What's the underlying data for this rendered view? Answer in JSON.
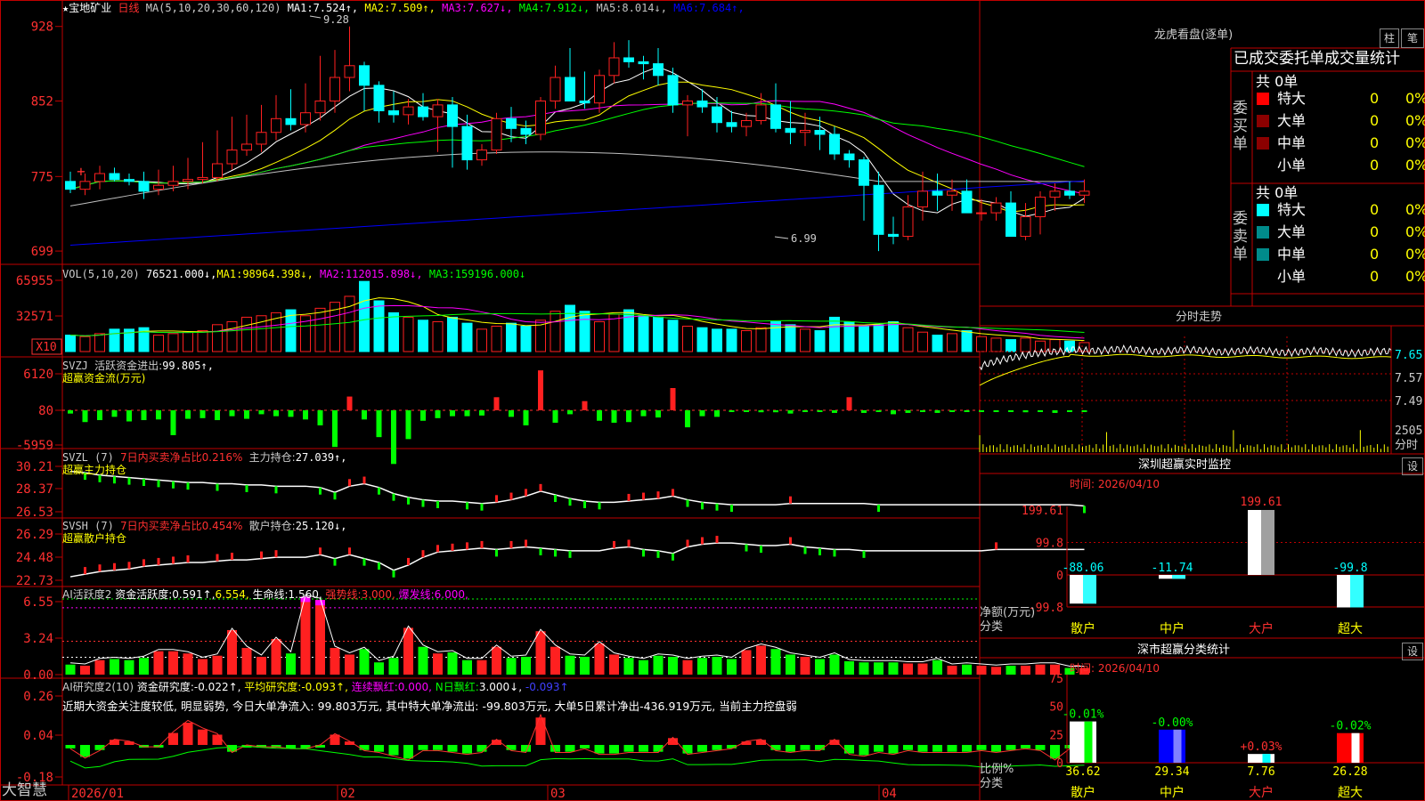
{
  "colors": {
    "up": "#ff2020",
    "down": "#00ffff",
    "green": "#00ff00",
    "grid": "#c00000",
    "ma1": "#ffffff",
    "ma2": "#ffff00",
    "ma3": "#ff00ff",
    "ma4": "#00ff00",
    "ma5": "#c0c0c0",
    "ma6": "#0000ff",
    "yellow": "#ffff00",
    "cyan": "#00ffff",
    "white": "#ffffff",
    "red": "#ff3030",
    "magenta": "#ff00ff"
  },
  "stock": {
    "name": "宝地矿业",
    "period": "日线",
    "star": "★"
  },
  "main": {
    "ma_params": "MA(5,10,20,30,60,120)",
    "ma_items": [
      {
        "label": "MA1:",
        "value": "7.524",
        "arrow": "↑",
        "key": "ma1"
      },
      {
        "label": "MA2:",
        "value": "7.509",
        "arrow": "↑",
        "key": "ma2"
      },
      {
        "label": "MA3:",
        "value": "7.627",
        "arrow": "↓",
        "key": "ma3"
      },
      {
        "label": "MA4:",
        "value": "7.912",
        "arrow": "↓",
        "key": "ma4"
      },
      {
        "label": "MA5:",
        "value": "8.014",
        "arrow": "↓",
        "key": "ma5"
      },
      {
        "label": "MA6:",
        "value": "7.684",
        "arrow": "↑",
        "key": "ma6"
      }
    ],
    "yticks": [
      "928",
      "852",
      "775",
      "699"
    ],
    "high_label": "9.28",
    "low_label": "6.99"
  },
  "vol": {
    "params": "VOL(5,10,20)",
    "value": "76521.000↓,",
    "items": [
      {
        "label": "MA1:",
        "value": "98964.398↓,",
        "key": "ma2"
      },
      {
        "label": "MA2:",
        "value": "112015.898↓,",
        "key": "ma3"
      },
      {
        "label": "MA3:",
        "value": "159196.000↓",
        "key": "ma4"
      }
    ],
    "yticks": [
      "65955",
      "32571"
    ],
    "unit": "X10"
  },
  "svzj": {
    "name": "SVZJ",
    "label": "活跃资金进出:",
    "value": "99.805↑,",
    "sub": "超赢资金流(万元)",
    "yticks": [
      "6120",
      "80",
      "-5959"
    ]
  },
  "svzl": {
    "name": "SVZL (7)",
    "label1": "7日内买卖净占比0.216%",
    "label2": "主力持仓:",
    "value": "27.039↑,",
    "sub": "超赢主力持仓",
    "yticks": [
      "30.21",
      "28.37",
      "26.53"
    ]
  },
  "svsh": {
    "name": "SVSH (7)",
    "label1": "7日内买卖净占比0.454%",
    "label2": "散户持仓:",
    "value": "25.120↓,",
    "sub": "超赢散户持仓",
    "yticks": [
      "26.29",
      "24.48",
      "22.73"
    ]
  },
  "ai1": {
    "name": "AI活跃度2",
    "l1": "资金活跃度:",
    "v1": "0.591↑,",
    "v2": "6.554,",
    "l3": "生命线:",
    "v3": "1.560,",
    "l4": "强势线:",
    "v4": "3.000,",
    "l5": "爆发线:",
    "v5": "6.000,",
    "yticks": [
      "6.55",
      "3.24",
      "0.00"
    ]
  },
  "ai2": {
    "name": "AI研究度2(10)",
    "l1": "资金研究度:",
    "v1": "-0.022↑,",
    "l2": "平均研究度:",
    "v2": "-0.093↑,",
    "l3": "连续飘红:",
    "v3": "0.000,",
    "l4": "N日飘红:",
    "v4": "3.000↓,",
    "v5": "-0.093↑",
    "desc": "近期大资金关注度较低, 明显弱势, 今日大单净流入: 99.803万元, 其中特大单净流出: -99.803万元, 大单5日累计净出-436.919万元, 当前主力控盘弱",
    "yticks": [
      "0.26",
      "0.04",
      "-0.18"
    ]
  },
  "xaxis": [
    "2026/01",
    "02",
    "03",
    "04"
  ],
  "brand": "大智慧",
  "panel": {
    "title": "龙虎看盘(逐单)",
    "tab1": "柱",
    "tab2": "笔",
    "header": "已成交委托单成交量统计",
    "buy_label": "委买单",
    "sell_label": "委卖单",
    "buy_total": "共 0单",
    "sell_total": "共 0单",
    "rows": [
      "特大",
      "大单",
      "中单",
      "小单"
    ],
    "zero": "0",
    "pct": "0%"
  },
  "intraday": {
    "title": "分时走势",
    "yticks": [
      "7.65",
      "7.57",
      "7.49"
    ],
    "vol_tick": "2505",
    "vol_unit": "分时"
  },
  "monitor": {
    "title": "深圳超赢实时监控",
    "btn": "设",
    "time_label": "时间:",
    "time": "2026/04/10",
    "ylabel1": "净额(万元)",
    "ylabel2": "分类",
    "yticks": [
      "199.61",
      "99.8",
      "0",
      "-99.8"
    ],
    "cats": [
      "散户",
      "中户",
      "大户",
      "超大"
    ],
    "values": [
      -88.06,
      -11.74,
      199.61,
      -99.8
    ],
    "value_labels": [
      "-88.06",
      "-11.74",
      "199.61",
      "-99.8"
    ]
  },
  "classify": {
    "title": "深市超赢分类统计",
    "btn": "设",
    "time_label": "时间:",
    "time": "2026/04/10",
    "ylabel1": "比例%",
    "ylabel2": "分类",
    "yticks": [
      "75",
      "50",
      "25",
      "0"
    ],
    "cats": [
      "散户",
      "中户",
      "大户",
      "超大"
    ],
    "values": [
      36.62,
      29.34,
      7.76,
      26.28
    ],
    "value_labels": [
      "36.62",
      "29.34",
      "7.76",
      "26.28"
    ],
    "changes": [
      "-0.01%",
      "-0.00%",
      "+0.03%",
      "-0.02%"
    ]
  },
  "chart_data": [
    {
      "type": "candlestick",
      "title": "宝地矿业 日线",
      "ylim": [
        6.9,
        9.35
      ],
      "open": [
        7.7,
        7.62,
        7.7,
        7.78,
        7.72,
        7.7,
        7.62,
        7.66,
        7.7,
        7.72,
        7.74,
        7.88,
        8.02,
        8.08,
        8.2,
        8.34,
        8.28,
        8.4,
        8.52,
        8.76,
        8.88,
        8.68,
        8.42,
        8.38,
        8.46,
        8.36,
        8.48,
        8.26,
        7.92,
        8.02,
        8.34,
        8.24,
        8.18,
        8.52,
        8.76,
        8.52,
        8.5,
        8.78,
        8.96,
        8.92,
        8.9,
        8.78,
        8.48,
        8.52,
        8.46,
        8.3,
        8.26,
        8.32,
        8.48,
        8.24,
        8.2,
        8.22,
        8.18,
        7.98,
        7.92,
        7.66,
        7.16,
        7.14,
        7.44,
        7.6,
        7.56,
        7.6,
        7.38,
        7.38,
        7.48,
        7.14,
        7.34,
        7.54,
        7.6,
        7.56
      ],
      "high": [
        7.8,
        7.78,
        7.86,
        7.84,
        7.78,
        7.8,
        7.82,
        7.86,
        7.94,
        8.1,
        8.22,
        8.36,
        8.38,
        8.48,
        8.58,
        8.64,
        8.7,
        8.98,
        9.04,
        9.28,
        8.92,
        8.72,
        8.62,
        8.54,
        8.6,
        8.54,
        8.56,
        8.38,
        8.08,
        8.4,
        8.46,
        8.32,
        8.56,
        8.88,
        9.06,
        8.82,
        8.84,
        9.12,
        9.14,
        8.98,
        9.06,
        8.86,
        8.58,
        8.64,
        8.56,
        8.42,
        8.4,
        8.6,
        8.7,
        8.52,
        8.4,
        8.36,
        8.26,
        8.02,
        7.95,
        7.8,
        7.34,
        7.56,
        7.8,
        7.78,
        7.72,
        7.72,
        7.52,
        7.54,
        7.6,
        7.48,
        7.6,
        7.68,
        7.7,
        7.72
      ],
      "low": [
        7.58,
        7.56,
        7.62,
        7.7,
        7.66,
        7.52,
        7.56,
        7.6,
        7.62,
        7.68,
        7.7,
        7.82,
        7.96,
        8.0,
        8.12,
        8.22,
        8.2,
        8.32,
        8.4,
        8.62,
        8.42,
        8.3,
        8.3,
        8.28,
        8.32,
        8.0,
        7.84,
        7.82,
        7.86,
        7.98,
        8.1,
        8.08,
        8.12,
        8.44,
        8.52,
        8.44,
        8.4,
        8.7,
        8.86,
        8.74,
        8.68,
        8.4,
        8.16,
        8.4,
        8.2,
        8.2,
        8.16,
        8.28,
        8.2,
        8.08,
        8.06,
        8.02,
        7.92,
        7.84,
        7.3,
        6.99,
        7.06,
        7.1,
        7.3,
        7.4,
        7.4,
        7.42,
        7.3,
        7.3,
        7.34,
        7.1,
        7.16,
        7.4,
        7.52,
        7.48
      ],
      "close": [
        7.62,
        7.7,
        7.78,
        7.72,
        7.7,
        7.6,
        7.66,
        7.7,
        7.72,
        7.74,
        7.88,
        8.02,
        8.08,
        8.2,
        8.34,
        8.28,
        8.4,
        8.52,
        8.76,
        8.88,
        8.68,
        8.42,
        8.38,
        8.46,
        8.36,
        8.48,
        8.26,
        7.92,
        8.02,
        8.34,
        8.24,
        8.18,
        8.52,
        8.76,
        8.52,
        8.5,
        8.78,
        8.96,
        8.92,
        8.9,
        8.78,
        8.48,
        8.52,
        8.46,
        8.3,
        8.26,
        8.32,
        8.48,
        8.24,
        8.2,
        8.22,
        8.18,
        7.98,
        7.92,
        7.66,
        7.16,
        7.14,
        7.44,
        7.6,
        7.56,
        7.6,
        7.38,
        7.38,
        7.48,
        7.14,
        7.34,
        7.54,
        7.6,
        7.56,
        7.6
      ]
    },
    {
      "type": "bar",
      "title": "VOL",
      "ylim": [
        0,
        99000
      ],
      "values": [
        22000,
        20000,
        24000,
        30000,
        30000,
        32000,
        22000,
        24000,
        26000,
        28000,
        36000,
        40000,
        46000,
        48000,
        52000,
        56000,
        48000,
        58000,
        66000,
        74000,
        94000,
        68000,
        52000,
        46000,
        42000,
        40000,
        46000,
        38000,
        30000,
        34000,
        38000,
        34000,
        42000,
        54000,
        62000,
        54000,
        40000,
        50000,
        56000,
        48000,
        46000,
        42000,
        34000,
        32000,
        30000,
        30000,
        28000,
        32000,
        40000,
        36000,
        30000,
        28000,
        46000,
        40000,
        34000,
        36000,
        40000,
        32000,
        26000,
        22000,
        24000,
        28000,
        20000,
        18000,
        16000,
        18000,
        14000,
        16000,
        14000,
        12000
      ]
    },
    {
      "type": "bar",
      "title": "超赢资金流(万元)",
      "ylim": [
        -5959,
        6120
      ],
      "values": [
        -500,
        -1800,
        -1500,
        -1000,
        -1700,
        -1500,
        -1400,
        -3800,
        -1300,
        -1200,
        -1500,
        -900,
        -1300,
        -600,
        -900,
        -1000,
        -1400,
        -2300,
        -5600,
        2100,
        -1400,
        -4100,
        -8200,
        -4400,
        -1600,
        -1200,
        -900,
        -900,
        -800,
        2000,
        -1000,
        -2300,
        6100,
        -1900,
        -600,
        1400,
        -1600,
        -1900,
        -1800,
        -900,
        -1100,
        3400,
        -2600,
        -900,
        -1000,
        -200,
        -200,
        -300,
        -300,
        -500,
        -200,
        -200,
        -400,
        2000,
        -400,
        -200,
        -600,
        -400,
        -200,
        -400,
        -200,
        -200,
        -200,
        -200,
        -200,
        -300,
        -200,
        -400,
        -200,
        -200
      ]
    },
    {
      "type": "line",
      "title": "超赢主力持仓",
      "ylim": [
        26.53,
        30.21
      ],
      "values": [
        29.8,
        29.7,
        29.5,
        29.4,
        29.3,
        29.2,
        29.1,
        29.0,
        28.9,
        28.9,
        28.8,
        28.8,
        28.7,
        28.7,
        28.6,
        28.6,
        28.6,
        28.5,
        28.1,
        28.6,
        28.8,
        28.5,
        28.0,
        27.7,
        27.5,
        27.4,
        27.4,
        27.3,
        27.2,
        27.3,
        27.5,
        27.8,
        28.2,
        27.9,
        27.6,
        27.4,
        27.3,
        27.3,
        27.4,
        27.5,
        27.6,
        27.8,
        27.5,
        27.3,
        27.2,
        27.1,
        27.1,
        27.1,
        27.1,
        27.2,
        27.2,
        27.2,
        27.2,
        27.2,
        27.2,
        27.1,
        27.1,
        27.1,
        27.1,
        27.1,
        27.1,
        27.1,
        27.1,
        27.1,
        27.1,
        27.1,
        27.1,
        27.1,
        27.1,
        27.0
      ]
    },
    {
      "type": "line",
      "title": "超赢散户持仓",
      "ylim": [
        22.73,
        26.29
      ],
      "values": [
        23.0,
        23.2,
        23.4,
        23.5,
        23.6,
        23.8,
        23.9,
        24.0,
        24.1,
        24.1,
        24.2,
        24.3,
        24.3,
        24.4,
        24.5,
        24.5,
        24.5,
        24.7,
        24.4,
        24.7,
        24.4,
        24.1,
        23.5,
        23.9,
        24.5,
        24.9,
        25.0,
        25.1,
        25.2,
        25.1,
        25.2,
        25.3,
        25.2,
        25.1,
        25.0,
        25.0,
        25.0,
        25.2,
        25.3,
        25.1,
        25.0,
        24.8,
        25.3,
        25.5,
        25.6,
        25.6,
        25.5,
        25.4,
        25.4,
        25.5,
        25.3,
        25.2,
        25.1,
        25.1,
        25.0,
        25.0,
        25.0,
        25.0,
        25.0,
        25.0,
        25.0,
        25.0,
        25.0,
        25.1,
        25.1,
        25.1,
        25.1,
        25.1,
        25.1,
        25.1
      ]
    },
    {
      "type": "bar",
      "title": "AI活跃度2",
      "ylim": [
        0,
        6.554
      ],
      "values": [
        0.9,
        0.8,
        1.3,
        1.4,
        1.3,
        1.5,
        2.1,
        2.1,
        1.9,
        1.4,
        1.7,
        4.0,
        2.4,
        1.6,
        3.2,
        1.9,
        7.0,
        6.7,
        2.4,
        1.8,
        2.3,
        1.1,
        1.5,
        4.2,
        2.5,
        1.9,
        2.0,
        1.3,
        1.3,
        2.5,
        1.5,
        1.6,
        3.9,
        2.5,
        1.7,
        1.6,
        2.8,
        1.8,
        1.5,
        1.3,
        1.7,
        1.6,
        1.3,
        1.5,
        1.6,
        1.4,
        2.2,
        2.6,
        2.3,
        1.8,
        1.6,
        1.4,
        1.8,
        1.2,
        1.1,
        1.1,
        1.1,
        1.0,
        1.0,
        1.3,
        0.8,
        0.9,
        0.8,
        0.7,
        0.8,
        0.8,
        0.9,
        0.9,
        0.6,
        0.6
      ]
    },
    {
      "type": "bar",
      "title": "AI研究度2(10)",
      "ylim": [
        -0.18,
        0.26
      ],
      "values": [
        -0.02,
        -0.07,
        -0.03,
        0.03,
        0.02,
        -0.01,
        -0.01,
        0.07,
        0.13,
        0.09,
        0.06,
        -0.04,
        0.0,
        -0.01,
        -0.01,
        -0.02,
        -0.02,
        0.0,
        0.06,
        0.02,
        -0.03,
        -0.04,
        -0.06,
        -0.08,
        -0.03,
        -0.03,
        -0.04,
        -0.05,
        -0.04,
        0.03,
        -0.03,
        -0.04,
        0.16,
        -0.04,
        -0.04,
        -0.02,
        -0.05,
        -0.05,
        -0.04,
        -0.04,
        -0.04,
        0.04,
        -0.05,
        -0.04,
        -0.03,
        -0.02,
        0.02,
        0.03,
        -0.03,
        -0.04,
        -0.03,
        -0.03,
        0.03,
        -0.05,
        -0.06,
        -0.04,
        -0.05,
        -0.03,
        -0.04,
        -0.04,
        -0.04,
        -0.04,
        -0.03,
        -0.04,
        -0.03,
        -0.02,
        -0.03,
        -0.08,
        -0.02,
        -0.02
      ]
    }
  ]
}
